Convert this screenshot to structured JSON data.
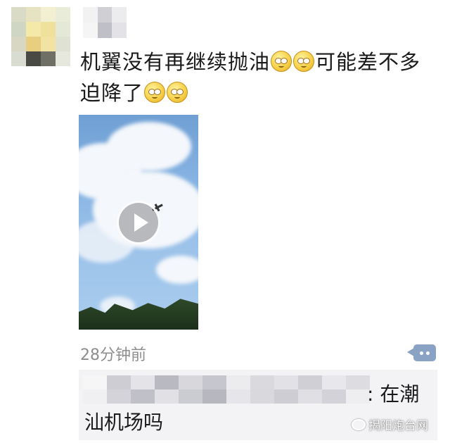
{
  "post": {
    "text_line1": "机翼没有再继续抛油",
    "text_after_emoji": "可能差不多",
    "text_line2": "迫降了",
    "emoji_icon": "dizzy-face-emoji"
  },
  "video": {
    "play_icon": "play-icon"
  },
  "meta": {
    "timestamp": "28分钟前",
    "comment_icon": "comment-dots-icon"
  },
  "comment": {
    "text_line1": ": 在潮",
    "text_line2": "汕机场吗"
  },
  "watermark": {
    "text": "揭阳炮台网",
    "icon": "wechat-icon"
  },
  "colors": {
    "timestamp": "#8e8e8e",
    "comment_button": "#8aa3c4",
    "comment_bg": "#f3f3f5"
  }
}
